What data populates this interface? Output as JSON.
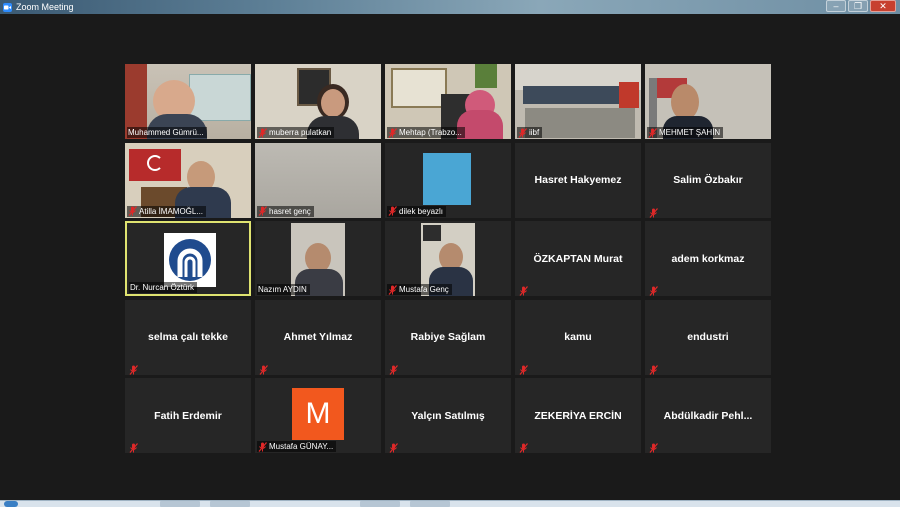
{
  "window": {
    "title": "Zoom Meeting",
    "min_label": "–",
    "max_label": "❐",
    "close_label": "✕"
  },
  "colors": {
    "background": "#1a1a1a",
    "tile": "#262626",
    "active_speaker_border": "#dfe370",
    "muted_mic": "#e02828"
  },
  "participants": [
    {
      "name": "Muhammed Gümrü...",
      "video": true,
      "muted": false
    },
    {
      "name": "muberra pulatkan",
      "video": true,
      "muted": true
    },
    {
      "name": "Mehtap (Trabzo...",
      "video": true,
      "muted": true
    },
    {
      "name": "iibf",
      "video": true,
      "muted": true
    },
    {
      "name": "MEHMET ŞAHİN",
      "video": true,
      "muted": true
    },
    {
      "name": "Atilla İMAMOĞL...",
      "video": true,
      "muted": true
    },
    {
      "name": "hasret genç",
      "video": true,
      "muted": true
    },
    {
      "name": "dilek beyazlı",
      "video": true,
      "muted": true
    },
    {
      "name": "Hasret Hakyemez",
      "video": false,
      "muted": false
    },
    {
      "name": "Salim Özbakır",
      "video": false,
      "muted": true
    },
    {
      "name": "Dr. Nurcan Öztürk",
      "video": true,
      "muted": false,
      "active": true
    },
    {
      "name": "Nazım AYDIN",
      "video": true,
      "muted": false
    },
    {
      "name": "Mustafa Genç",
      "video": true,
      "muted": true
    },
    {
      "name": "ÖZKAPTAN Murat",
      "video": false,
      "muted": true
    },
    {
      "name": "adem korkmaz",
      "video": false,
      "muted": true
    },
    {
      "name": "selma çalı tekke",
      "video": false,
      "muted": true
    },
    {
      "name": "Ahmet Yılmaz",
      "video": false,
      "muted": true
    },
    {
      "name": "Rabiye Sağlam",
      "video": false,
      "muted": true
    },
    {
      "name": "kamu",
      "video": false,
      "muted": true
    },
    {
      "name": "endustri",
      "video": false,
      "muted": true
    },
    {
      "name": "Fatih Erdemir",
      "video": false,
      "muted": true
    },
    {
      "name": "Mustafa GÜNAY...",
      "video": false,
      "muted": true,
      "avatar_letter": "M",
      "avatar_color": "#f2581e"
    },
    {
      "name": "Yalçın Satılmış",
      "video": false,
      "muted": true
    },
    {
      "name": "ZEKERİYA ERCİN",
      "video": false,
      "muted": true
    },
    {
      "name": "Abdülkadir  Pehl...",
      "video": false,
      "muted": true
    }
  ]
}
